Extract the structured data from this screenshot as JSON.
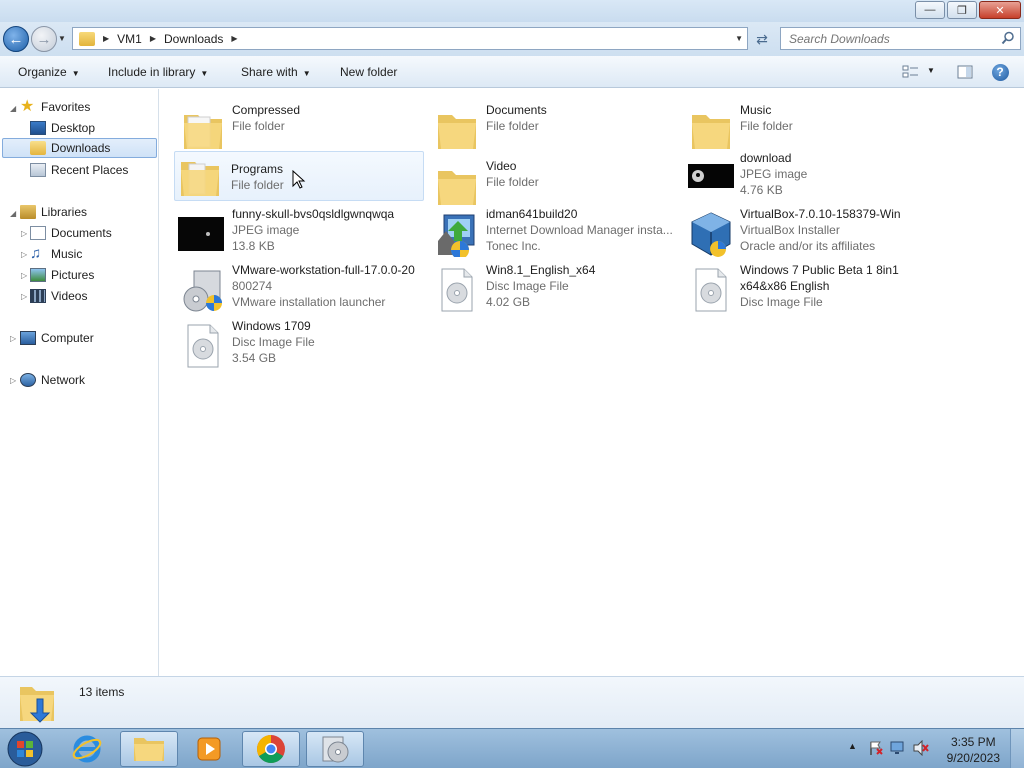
{
  "window": {
    "buttons": {
      "minimize": "—",
      "maximize": "❐",
      "close": "✕"
    }
  },
  "navbar": {
    "breadcrumbs": [
      "VM1",
      "Downloads"
    ],
    "search_placeholder": "Search Downloads"
  },
  "commandbar": {
    "organize": "Organize",
    "include_in_library": "Include in library",
    "share_with": "Share with",
    "new_folder": "New folder",
    "help": "?"
  },
  "navpane": {
    "favorites": "Favorites",
    "favorites_items": [
      "Desktop",
      "Downloads",
      "Recent Places"
    ],
    "libraries": "Libraries",
    "libraries_items": [
      "Documents",
      "Music",
      "Pictures",
      "Videos"
    ],
    "computer": "Computer",
    "network": "Network"
  },
  "files": [
    {
      "name": "Compressed",
      "type": "File folder",
      "extra": "",
      "icon": "folder-icon"
    },
    {
      "name": "Documents",
      "type": "File folder",
      "extra": "",
      "icon": "folder-icon"
    },
    {
      "name": "Music",
      "type": "File folder",
      "extra": "",
      "icon": "folder-icon"
    },
    {
      "name": "Programs",
      "type": "File folder",
      "extra": "",
      "icon": "folder-icon"
    },
    {
      "name": "Video",
      "type": "File folder",
      "extra": "",
      "icon": "folder-icon"
    },
    {
      "name": "download",
      "type": "JPEG image",
      "extra": "4.76 KB",
      "icon": "image-thumbnail-icon"
    },
    {
      "name": "funny-skull-bvs0qsldlgwnqwqa",
      "type": "JPEG image",
      "extra": "13.8 KB",
      "icon": "image-thumbnail-icon"
    },
    {
      "name": "idman641build20",
      "type": "Internet Download Manager insta...",
      "extra": "Tonec Inc.",
      "icon": "installer-icon"
    },
    {
      "name": "VirtualBox-7.0.10-158379-Win",
      "type": "VirtualBox Installer",
      "extra": "Oracle and/or its affiliates",
      "icon": "virtualbox-icon"
    },
    {
      "name": "VMware-workstation-full-17.0.0-20",
      "name2": "800274",
      "type": "VMware installation launcher",
      "extra": "",
      "icon": "vmware-installer-icon"
    },
    {
      "name": "Win8.1_English_x64",
      "type": "Disc Image File",
      "extra": "4.02 GB",
      "icon": "disc-image-icon"
    },
    {
      "name": "Windows 7 Public Beta 1 8in1",
      "name2": "x64&x86 English",
      "type": "Disc Image File",
      "extra": "",
      "icon": "disc-image-icon"
    },
    {
      "name": "Windows 1709",
      "type": "Disc Image File",
      "extra": "3.54 GB",
      "icon": "disc-image-icon"
    }
  ],
  "details": {
    "count": "13 items"
  },
  "taskbar": {
    "apps": [
      "start-orb-icon",
      "internet-explorer-icon",
      "file-explorer-icon",
      "media-player-icon",
      "chrome-icon",
      "disc-burner-icon"
    ]
  },
  "tray": {
    "time": "3:35 PM",
    "date": "9/20/2023",
    "overflow": "▲"
  }
}
